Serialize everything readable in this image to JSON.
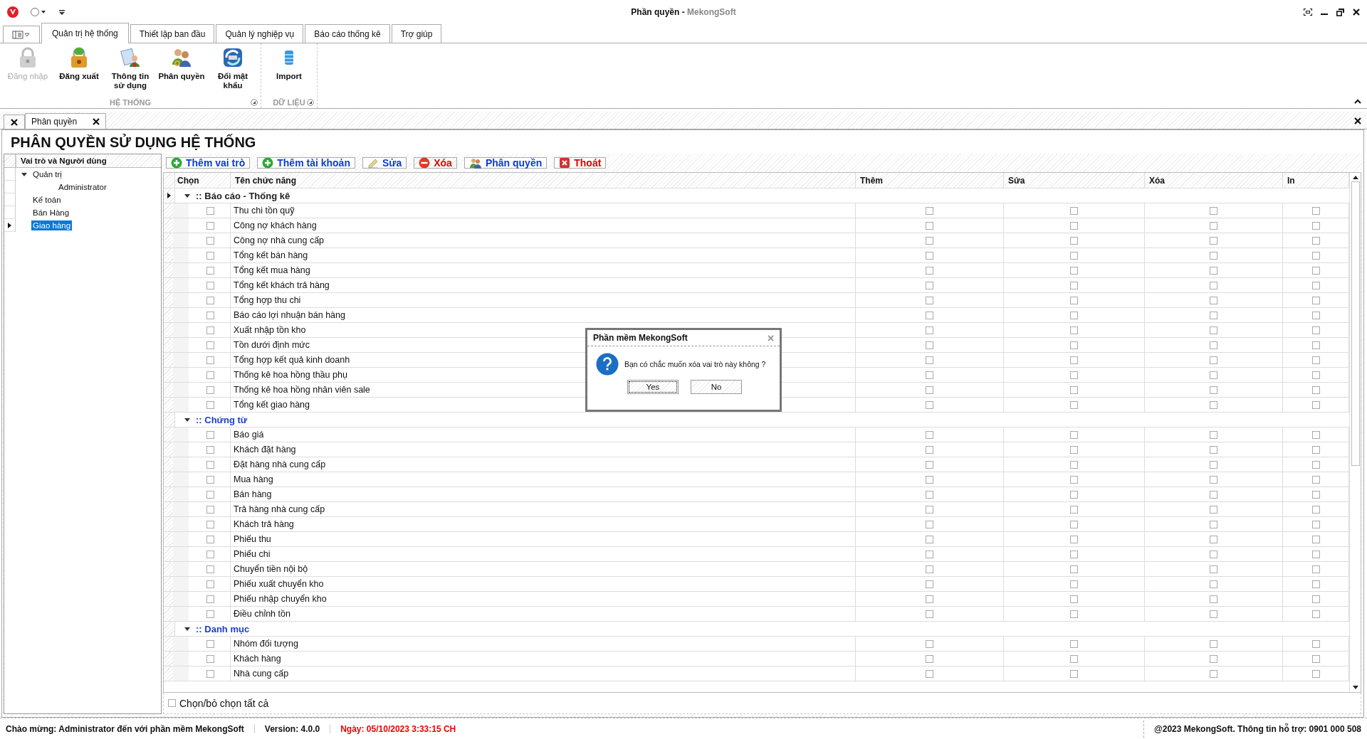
{
  "window": {
    "title": "Phần quyền",
    "separator": "-",
    "app_name": "MekongSoft"
  },
  "ribbon_tabs": [
    {
      "label": "Quản trị hệ thống",
      "selected": true
    },
    {
      "label": "Thiết lập ban đầu",
      "selected": false
    },
    {
      "label": "Quản lý nghiệp vụ",
      "selected": false
    },
    {
      "label": "Báo cáo thống kê",
      "selected": false
    },
    {
      "label": "Trợ giúp",
      "selected": false
    }
  ],
  "ribbon_groups": [
    {
      "label": "HỆ THỐNG",
      "buttons": [
        {
          "label": "Đăng nhập",
          "kind": "lock",
          "disabled": true
        },
        {
          "label": "Đăng xuất",
          "kind": "logout",
          "disabled": false
        },
        {
          "label": "Thông tin sử dụng",
          "kind": "info",
          "disabled": false
        },
        {
          "label": "Phân quyền",
          "kind": "users",
          "disabled": false
        },
        {
          "label": "Đổi mật khẩu",
          "kind": "password",
          "disabled": false
        }
      ]
    },
    {
      "label": "DỮ LIỆU",
      "buttons": [
        {
          "label": "Import",
          "kind": "database",
          "disabled": false
        }
      ]
    }
  ],
  "document_tabs": [
    {
      "label": "Phân quyền",
      "selected": true
    }
  ],
  "page_title": "PHÂN QUYỀN SỬ DỤNG HỆ THỐNG",
  "roles_panel": {
    "header": "Vai trò và Người dùng",
    "tree": [
      {
        "label": "Quản trị",
        "expanded": true,
        "selected": false,
        "children": [
          {
            "label": "Administrator",
            "selected": false
          }
        ]
      },
      {
        "label": "Kế toán",
        "selected": false
      },
      {
        "label": "Bán Hàng",
        "selected": false
      },
      {
        "label": "Giao hàng",
        "selected": true
      }
    ]
  },
  "toolbar": [
    {
      "label": "Thêm vai trò",
      "kind": "add"
    },
    {
      "label": "Thêm tài khoản",
      "kind": "add"
    },
    {
      "label": "Sửa",
      "kind": "edit"
    },
    {
      "label": "Xóa",
      "kind": "delete"
    },
    {
      "label": "Phân quyền",
      "kind": "permission"
    },
    {
      "label": "Thoát",
      "kind": "exit"
    }
  ],
  "table": {
    "columns": [
      "Chọn",
      "Tên chức năng",
      "Thêm",
      "Sửa",
      "Xóa",
      "In"
    ],
    "groups": [
      {
        "title": ":: Báo cáo - Thống kê",
        "expanded": true,
        "selected": true,
        "items": [
          {
            "name": "Thu chi tồn quỹ",
            "checks": [
              false,
              false,
              false,
              false,
              false
            ]
          },
          {
            "name": "Công nợ khách hàng",
            "checks": [
              false,
              false,
              false,
              false,
              false
            ]
          },
          {
            "name": "Công nợ nhà cung cấp",
            "checks": [
              false,
              false,
              false,
              false,
              false
            ]
          },
          {
            "name": "Tổng kết bán hàng",
            "checks": [
              false,
              false,
              false,
              false,
              false
            ]
          },
          {
            "name": "Tổng kết mua hàng",
            "checks": [
              false,
              false,
              false,
              false,
              false
            ]
          },
          {
            "name": "Tổng kết khách trả hàng",
            "checks": [
              false,
              false,
              false,
              false,
              false
            ]
          },
          {
            "name": "Tổng hợp thu chi",
            "checks": [
              false,
              false,
              false,
              false,
              false
            ]
          },
          {
            "name": "Báo cáo lợi nhuận bán hàng",
            "checks": [
              false,
              false,
              false,
              false,
              false
            ]
          },
          {
            "name": "Xuất nhập tồn kho",
            "checks": [
              false,
              false,
              false,
              false,
              false
            ]
          },
          {
            "name": "Tồn dưới định mức",
            "checks": [
              false,
              false,
              false,
              false,
              false
            ]
          },
          {
            "name": "Tổng hợp kết quả kinh doanh",
            "checks": [
              false,
              false,
              false,
              false,
              false
            ]
          },
          {
            "name": "Thống kê hoa hồng thầu phụ",
            "checks": [
              false,
              false,
              false,
              false,
              false
            ]
          },
          {
            "name": "Thống kê hoa hồng nhân viên sale",
            "checks": [
              false,
              false,
              false,
              false,
              false
            ]
          },
          {
            "name": "Tổng kết giao hàng",
            "checks": [
              false,
              false,
              false,
              false,
              false
            ]
          }
        ]
      },
      {
        "title": ":: Chứng từ",
        "expanded": true,
        "selected": false,
        "items": [
          {
            "name": "Báo giá",
            "checks": [
              false,
              false,
              false,
              false,
              false
            ]
          },
          {
            "name": "Khách đặt hàng",
            "checks": [
              false,
              false,
              false,
              false,
              false
            ]
          },
          {
            "name": "Đặt hàng nhà cung cấp",
            "checks": [
              false,
              false,
              false,
              false,
              false
            ]
          },
          {
            "name": "Mua hàng",
            "checks": [
              false,
              false,
              false,
              false,
              false
            ]
          },
          {
            "name": "Bán hàng",
            "checks": [
              false,
              false,
              false,
              false,
              false
            ]
          },
          {
            "name": "Trả hàng nhà cung cấp",
            "checks": [
              false,
              false,
              false,
              false,
              false
            ]
          },
          {
            "name": "Khách trả hàng",
            "checks": [
              false,
              false,
              false,
              false,
              false
            ]
          },
          {
            "name": "Phiếu thu",
            "checks": [
              false,
              false,
              false,
              false,
              false
            ]
          },
          {
            "name": "Phiếu chi",
            "checks": [
              false,
              false,
              false,
              false,
              false
            ]
          },
          {
            "name": "Chuyển tiền nội bộ",
            "checks": [
              false,
              false,
              false,
              false,
              false
            ]
          },
          {
            "name": "Phiếu xuất chuyển kho",
            "checks": [
              false,
              false,
              false,
              false,
              false
            ]
          },
          {
            "name": "Phiếu nhập chuyển kho",
            "checks": [
              false,
              false,
              false,
              false,
              false
            ]
          },
          {
            "name": "Điều chỉnh tồn",
            "checks": [
              false,
              false,
              false,
              false,
              false
            ]
          }
        ]
      },
      {
        "title": ":: Danh mục",
        "expanded": true,
        "selected": false,
        "items": [
          {
            "name": "Nhóm đối tượng",
            "checks": [
              false,
              false,
              false,
              false,
              false
            ]
          },
          {
            "name": "Khách hàng",
            "checks": [
              false,
              false,
              false,
              false,
              false
            ]
          },
          {
            "name": "Nhà cung cấp",
            "checks": [
              false,
              false,
              false,
              false,
              false
            ]
          }
        ]
      }
    ]
  },
  "select_all": {
    "label": "Chọn/bỏ chọn tất cả",
    "checked": false
  },
  "dialog": {
    "title": "Phần mềm MekongSoft",
    "message": "Bạn có chắc muốn xóa vai trò này không ?",
    "buttons": [
      {
        "label": "Yes",
        "selected": true
      },
      {
        "label": "No",
        "selected": false
      }
    ]
  },
  "status_bar": {
    "welcome": "Chào mừng: Administrator đến với phần mềm MekongSoft",
    "version": "Version: 4.0.0",
    "date": "Ngày: 05/10/2023 3:33:15 CH",
    "support": "@2023 MekongSoft. Thông tin hỗ trợ: 0901 000 508"
  }
}
